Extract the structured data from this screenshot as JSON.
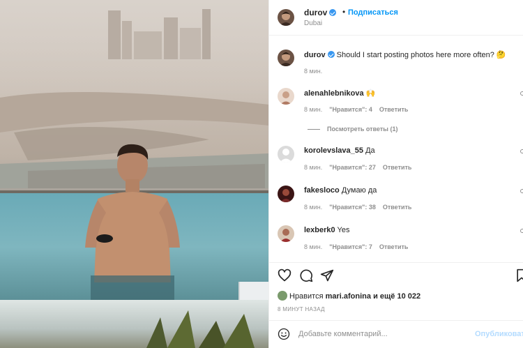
{
  "post": {
    "header": {
      "username": "durov",
      "separator": "•",
      "follow_label": "Подписаться",
      "location": "Dubai"
    },
    "caption": {
      "username": "durov",
      "text": "Should I start posting photos here more often? 🤔",
      "time": "8 мин."
    },
    "comments": [
      {
        "username": "alenahlebnikova",
        "text": "🙌",
        "time": "8 мин.",
        "likes": "\"Нравится\": 4",
        "reply": "Ответить",
        "avatar_color": "#c9a088"
      },
      {
        "username": "korolevslava_55",
        "text": "Да",
        "time": "8 мин.",
        "likes": "\"Нравится\": 27",
        "reply": "Ответить",
        "avatar_color": "#dbdbdb"
      },
      {
        "username": "fakesloco",
        "text": "Думаю да",
        "time": "8 мин.",
        "likes": "\"Нравится\": 38",
        "reply": "Ответить",
        "avatar_color": "#7a2a2a"
      },
      {
        "username": "lexberk0",
        "text": "Yes",
        "time": "8 мин.",
        "likes": "\"Нравится\": 7",
        "reply": "Ответить",
        "avatar_color": "#7d3a3a"
      }
    ],
    "view_replies": "Посмотреть ответы (1)",
    "actions": {
      "icons": [
        "heart-icon",
        "comment-icon",
        "share-icon",
        "bookmark-icon"
      ]
    },
    "likes": {
      "prefix": "Нравится",
      "user": "mari.afonina",
      "suffix": "и ещё 10 022"
    },
    "timestamp": "8 МИНУТ НАЗАД",
    "comment_input": {
      "placeholder": "Добавьте комментарий...",
      "publish_label": "Опубликовать"
    }
  },
  "colors": {
    "link_blue": "#0095f6",
    "verified_blue": "#3897f0",
    "publish_disabled": "#b3dbff",
    "muted": "#8e8e8e"
  }
}
